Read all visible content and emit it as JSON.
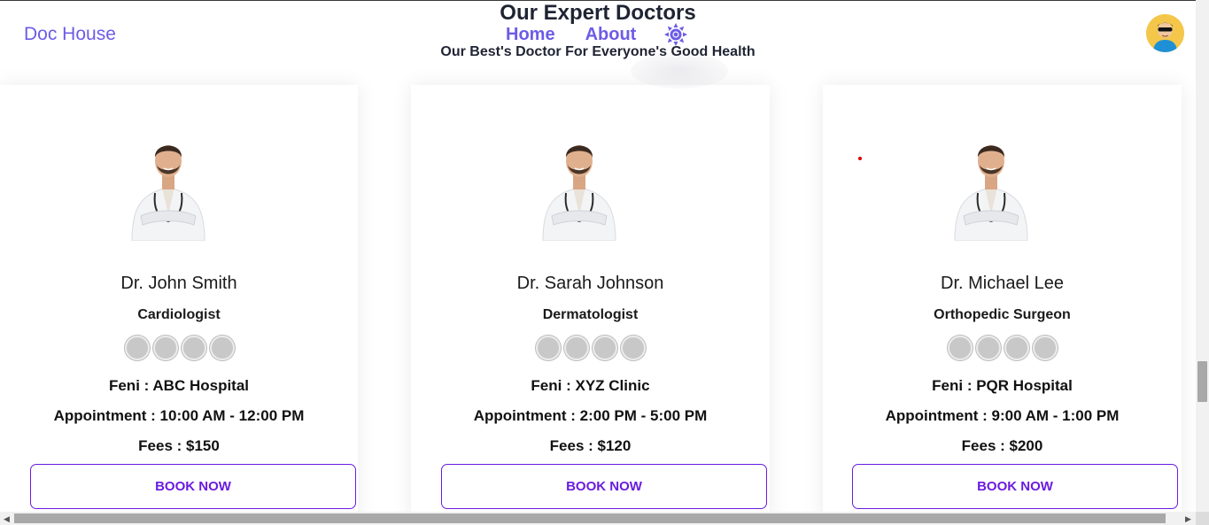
{
  "brand": "Doc House",
  "nav": {
    "home": "Home",
    "about": "About"
  },
  "heading": {
    "title": "Our Expert Doctors",
    "subtitle": "Our Best's Doctor For Everyone's Good Health"
  },
  "labels": {
    "location": "Feni : ",
    "appointment": "Appointment : ",
    "fees": "Fees : "
  },
  "doctors": [
    {
      "name": "Dr. John Smith",
      "specialty": "Cardiologist",
      "location": "ABC Hospital",
      "appointment": "10:00 AM - 12:00 PM",
      "fees": "$150",
      "button": "BOOK NOW"
    },
    {
      "name": "Dr. Sarah Johnson",
      "specialty": "Dermatologist",
      "location": "XYZ Clinic",
      "appointment": "2:00 PM - 5:00 PM",
      "fees": "$120",
      "button": "BOOK NOW"
    },
    {
      "name": "Dr. Michael Lee",
      "specialty": "Orthopedic Surgeon",
      "location": "PQR Hospital",
      "appointment": "9:00 AM - 1:00 PM",
      "fees": "$200",
      "button": "BOOK NOW"
    }
  ],
  "icons": {
    "theme": "sun-icon",
    "avatar": "user-avatar-icon",
    "rating": "rating-circle-icon"
  },
  "colors": {
    "accent": "#6c5ce7",
    "button": "#6a1be0"
  }
}
